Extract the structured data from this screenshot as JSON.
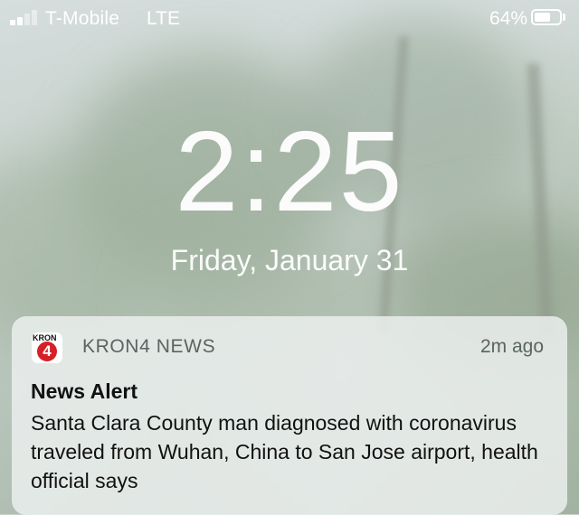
{
  "status_bar": {
    "carrier": "T-Mobile",
    "network": "LTE",
    "battery_percent": "64%",
    "battery_level": 0.64,
    "signal_bars_active": 2,
    "signal_bars_total": 4,
    "signal_icon": "signal-icon",
    "battery_icon": "battery-icon"
  },
  "lock_screen": {
    "time": "2:25",
    "date": "Friday, January 31"
  },
  "notification": {
    "app_icon_text": "KRON",
    "app_icon_badge": "4",
    "app_name": "KRON4 NEWS",
    "time_ago": "2m ago",
    "title": "News Alert",
    "body": "Santa Clara County man diagnosed with coronavirus traveled from Wuhan, China to San Jose airport, health official says"
  },
  "colors": {
    "badge_red": "#d62027",
    "text_white": "#ffffff",
    "notification_background": "#ecf0ee"
  }
}
